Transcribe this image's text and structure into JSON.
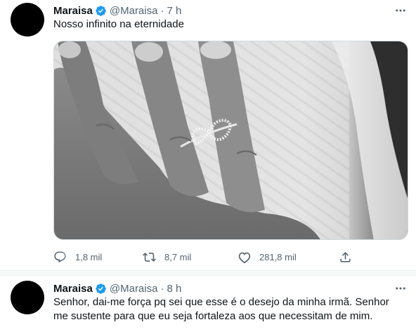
{
  "tweets": [
    {
      "name": "Maraisa",
      "handle": "@Maraisa",
      "separator": "·",
      "time": "7 h",
      "text": "Nosso infinito na eternidade",
      "media": {
        "description_icon": "photo",
        "has_image": true
      },
      "actions": {
        "reply_count": "1,8 mil",
        "retweet_count": "8,7 mil",
        "like_count": "281,8 mil"
      }
    },
    {
      "name": "Maraisa",
      "handle": "@Maraisa",
      "separator": "·",
      "time": "8 h",
      "text": "Senhor, dai-me força pq sei que esse é o desejo da minha irmã. Senhor me sustente para que eu seja fortaleza aos que necessitam de mim."
    }
  ],
  "colors": {
    "verified": "#1d9bf0",
    "secondary_text": "#536471",
    "primary_text": "#0f1419",
    "divider": "#f7f9f9"
  },
  "icons": [
    "verified-badge-icon",
    "more-icon",
    "reply-icon",
    "retweet-icon",
    "like-icon",
    "share-icon"
  ]
}
